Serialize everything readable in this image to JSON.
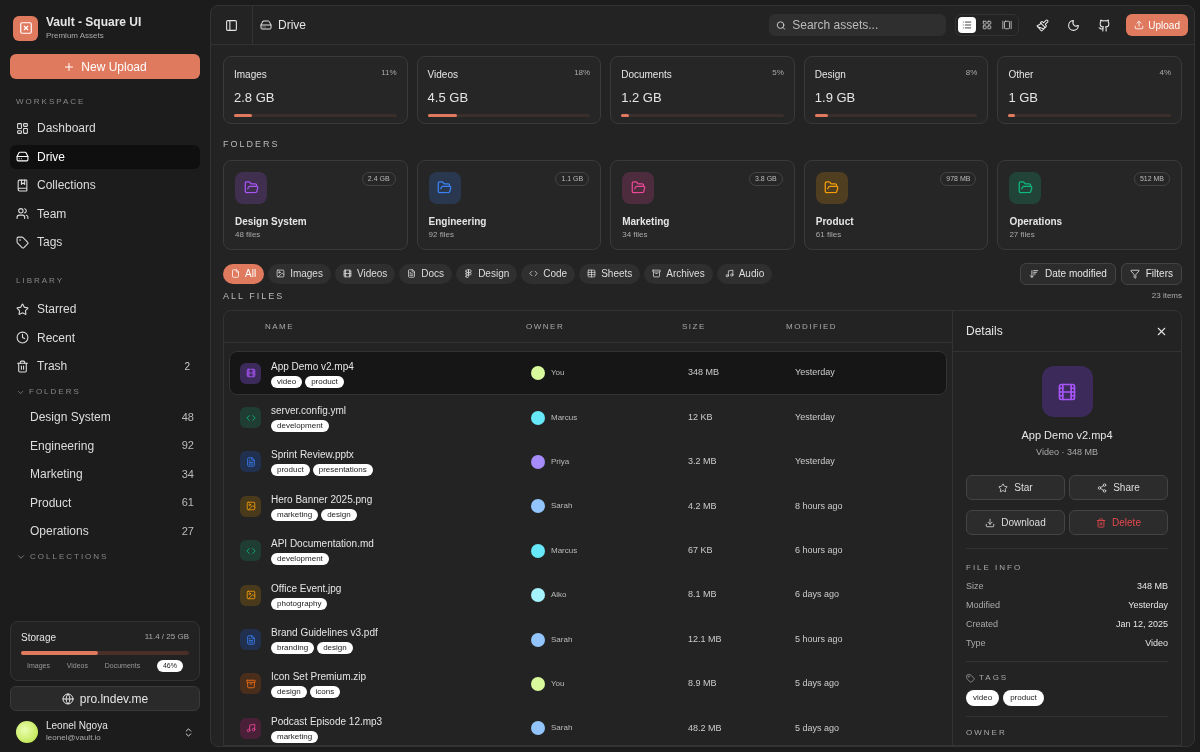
{
  "sidebar": {
    "brand": {
      "title": "Vault - Square UI",
      "subtitle": "Premium Assets"
    },
    "new_upload": "New Upload",
    "workspace": {
      "heading": "WORKSPACE",
      "items": [
        {
          "label": "Dashboard",
          "selected": false
        },
        {
          "label": "Drive",
          "selected": true
        },
        {
          "label": "Collections",
          "selected": false
        },
        {
          "label": "Team",
          "selected": false
        },
        {
          "label": "Tags",
          "selected": false
        }
      ]
    },
    "library": {
      "heading": "LIBRARY",
      "items": [
        {
          "label": "Starred"
        },
        {
          "label": "Recent"
        },
        {
          "label": "Trash",
          "count": "2"
        }
      ]
    },
    "folders": {
      "heading": "FOLDERS",
      "expanded": true,
      "items": [
        {
          "label": "Design System",
          "count": "48"
        },
        {
          "label": "Engineering",
          "count": "92"
        },
        {
          "label": "Marketing",
          "count": "34"
        },
        {
          "label": "Product",
          "count": "61"
        },
        {
          "label": "Operations",
          "count": "27"
        }
      ]
    },
    "collections": {
      "heading": "COLLECTIONS",
      "expanded": false
    },
    "storage": {
      "title": "Storage",
      "reading": "11.4 / 25 GB",
      "level": 0.46,
      "legend": [
        "Images",
        "Videos",
        "Documents"
      ],
      "percent": "46%"
    },
    "link": "pro.lndev.me",
    "user": {
      "name": "Leonel Ngoya",
      "email": "leonel@vault.io"
    }
  },
  "header": {
    "breadcrumb": "Drive",
    "search": {
      "placeholder": "Search assets..."
    },
    "views": [
      {
        "selected": true
      },
      {
        "selected": false
      },
      {
        "selected": false
      }
    ],
    "upload": "Upload"
  },
  "stats": [
    {
      "label": "Images",
      "percent": "11%",
      "value": "2.8 GB",
      "level": 0.11
    },
    {
      "label": "Videos",
      "percent": "18%",
      "value": "4.5 GB",
      "level": 0.18
    },
    {
      "label": "Documents",
      "percent": "5%",
      "value": "1.2 GB",
      "level": 0.05
    },
    {
      "label": "Design",
      "percent": "8%",
      "value": "1.9 GB",
      "level": 0.08
    },
    {
      "label": "Other",
      "percent": "4%",
      "value": "1 GB",
      "level": 0.04
    }
  ],
  "folders": {
    "heading": "FOLDERS",
    "items": [
      {
        "name": "Design System",
        "files": "48 files",
        "size": "2.4 GB",
        "color": "#a855f7"
      },
      {
        "name": "Engineering",
        "files": "92 files",
        "size": "1.1 GB",
        "color": "#3b82f6"
      },
      {
        "name": "Marketing",
        "files": "34 files",
        "size": "3.8 GB",
        "color": "#ec4899"
      },
      {
        "name": "Product",
        "files": "61 files",
        "size": "978 MB",
        "color": "#f59e0b"
      },
      {
        "name": "Operations",
        "files": "27 files",
        "size": "512 MB",
        "color": "#10b981"
      }
    ]
  },
  "filters": [
    {
      "label": "All",
      "selected": true
    },
    {
      "label": "Images",
      "selected": false
    },
    {
      "label": "Videos",
      "selected": false
    },
    {
      "label": "Docs",
      "selected": false
    },
    {
      "label": "Design",
      "selected": false
    },
    {
      "label": "Code",
      "selected": false
    },
    {
      "label": "Sheets",
      "selected": false
    },
    {
      "label": "Archives",
      "selected": false
    },
    {
      "label": "Audio",
      "selected": false
    }
  ],
  "sort": "Date modified",
  "filters_button": "Filters",
  "files": {
    "heading": "ALL FILES",
    "count": "23 items",
    "columns": [
      "NAME",
      "OWNER",
      "SIZE",
      "MODIFIED"
    ],
    "rows": [
      {
        "kind": "video",
        "name": "App Demo v2.mp4",
        "tags": [
          "video",
          "product"
        ],
        "owner": {
          "name": "You",
          "color": "#d9f99d"
        },
        "size": "348 MB",
        "modified": "Yesterday",
        "selected": true
      },
      {
        "kind": "code",
        "name": "server.config.yml",
        "tags": [
          "development"
        ],
        "owner": {
          "name": "Marcus",
          "color": "#67e8f9"
        },
        "size": "12 KB",
        "modified": "Yesterday",
        "selected": false
      },
      {
        "kind": "doc",
        "name": "Sprint Review.pptx",
        "tags": [
          "product",
          "presentations"
        ],
        "owner": {
          "name": "Priya",
          "color": "#a78bfa"
        },
        "size": "3.2 MB",
        "modified": "Yesterday",
        "selected": false
      },
      {
        "kind": "image",
        "name": "Hero Banner 2025.png",
        "tags": [
          "marketing",
          "design"
        ],
        "owner": {
          "name": "Sarah",
          "color": "#93c5fd"
        },
        "size": "4.2 MB",
        "modified": "8 hours ago",
        "selected": false
      },
      {
        "kind": "code",
        "name": "API Documentation.md",
        "tags": [
          "development"
        ],
        "owner": {
          "name": "Marcus",
          "color": "#67e8f9"
        },
        "size": "67 KB",
        "modified": "6 hours ago",
        "selected": false
      },
      {
        "kind": "image",
        "name": "Office Event.jpg",
        "tags": [
          "photography"
        ],
        "owner": {
          "name": "Aiko",
          "color": "#a5f3fc"
        },
        "size": "8.1 MB",
        "modified": "6 days ago",
        "selected": false
      },
      {
        "kind": "doc",
        "name": "Brand Guidelines v3.pdf",
        "tags": [
          "branding",
          "design"
        ],
        "owner": {
          "name": "Sarah",
          "color": "#93c5fd"
        },
        "size": "12.1 MB",
        "modified": "5 hours ago",
        "selected": false
      },
      {
        "kind": "archive",
        "name": "Icon Set Premium.zip",
        "tags": [
          "design",
          "icons"
        ],
        "owner": {
          "name": "You",
          "color": "#d9f99d"
        },
        "size": "8.9 MB",
        "modified": "5 days ago",
        "selected": false
      },
      {
        "kind": "audio",
        "name": "Podcast Episode 12.mp3",
        "tags": [
          "marketing"
        ],
        "owner": {
          "name": "Sarah",
          "color": "#93c5fd"
        },
        "size": "48.2 MB",
        "modified": "5 days ago",
        "selected": false
      }
    ]
  },
  "details": {
    "title": "Details",
    "kind": "video",
    "name": "App Demo v2.mp4",
    "subtitle": "Video · 348 MB",
    "actions": [
      {
        "label": "Star",
        "kind": "normal"
      },
      {
        "label": "Share",
        "kind": "normal"
      },
      {
        "label": "Download",
        "kind": "normal"
      },
      {
        "label": "Delete",
        "kind": "danger"
      }
    ],
    "info_heading": "FILE INFO",
    "info": [
      {
        "label": "Size",
        "value": "348 MB"
      },
      {
        "label": "Modified",
        "value": "Yesterday"
      },
      {
        "label": "Created",
        "value": "Jan 12, 2025"
      },
      {
        "label": "Type",
        "value": "Video"
      }
    ],
    "tags_heading": "TAGS",
    "tags": [
      "video",
      "product"
    ],
    "owner_heading": "OWNER"
  }
}
